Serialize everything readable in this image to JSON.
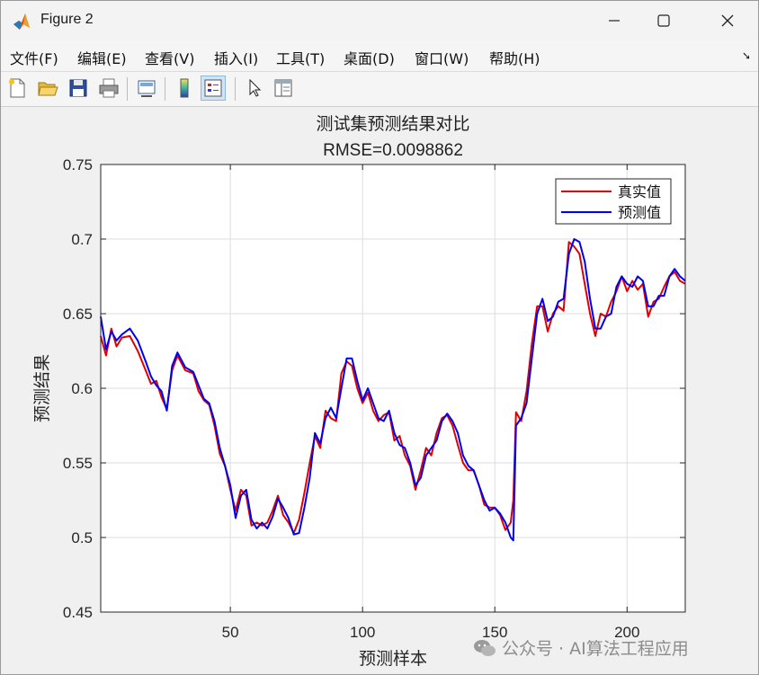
{
  "window": {
    "title": "Figure 2"
  },
  "menu": [
    "文件(F)",
    "编辑(E)",
    "查看(V)",
    "插入(I)",
    "工具(T)",
    "桌面(D)",
    "窗口(W)",
    "帮助(H)"
  ],
  "toolbar_icons": [
    "new-figure-icon",
    "open-file-icon",
    "save-icon",
    "print-icon",
    "link-plot-icon",
    "colorbar-icon",
    "legend-icon",
    "pointer-icon",
    "property-inspector-icon"
  ],
  "watermark": "公众号 · AI算法工程应用",
  "colors": {
    "true_line": "#e00000",
    "pred_line": "#0000f0"
  },
  "chart_data": {
    "type": "line",
    "title": "测试集预测结果对比",
    "subtitle": "RMSE=0.0098862",
    "xlabel": "预测样本",
    "ylabel": "预测结果",
    "xlim": [
      1,
      222
    ],
    "ylim": [
      0.45,
      0.75
    ],
    "xticks": [
      50,
      100,
      150,
      200
    ],
    "yticks": [
      0.45,
      0.5,
      0.55,
      0.6,
      0.65,
      0.7,
      0.75
    ],
    "xtick_labels": [
      "50",
      "100",
      "150",
      "200"
    ],
    "ytick_labels": [
      "0.45",
      "0.5",
      "0.55",
      "0.6",
      "0.65",
      "0.7",
      "0.75"
    ],
    "grid": true,
    "legend_position": "top-right",
    "series": [
      {
        "name": "真实值",
        "color": "#e00000",
        "x": [
          1,
          3,
          5,
          7,
          9,
          12,
          15,
          18,
          20,
          22,
          24,
          26,
          28,
          30,
          33,
          36,
          38,
          40,
          42,
          44,
          46,
          48,
          50,
          52,
          54,
          56,
          58,
          60,
          62,
          64,
          66,
          68,
          70,
          72,
          74,
          76,
          78,
          80,
          82,
          84,
          86,
          88,
          90,
          92,
          94,
          96,
          98,
          100,
          102,
          104,
          106,
          108,
          110,
          112,
          114,
          116,
          118,
          120,
          122,
          124,
          126,
          128,
          130,
          132,
          134,
          136,
          138,
          140,
          142,
          144,
          146,
          148,
          150,
          152,
          154,
          156,
          157,
          158,
          160,
          162,
          164,
          166,
          168,
          170,
          172,
          174,
          176,
          178,
          180,
          182,
          184,
          186,
          188,
          190,
          192,
          194,
          196,
          198,
          200,
          202,
          204,
          206,
          208,
          210,
          212,
          214,
          216,
          218,
          220,
          222
        ],
        "y": [
          0.635,
          0.622,
          0.64,
          0.628,
          0.634,
          0.635,
          0.625,
          0.612,
          0.603,
          0.605,
          0.594,
          0.586,
          0.612,
          0.622,
          0.612,
          0.61,
          0.598,
          0.592,
          0.589,
          0.575,
          0.556,
          0.548,
          0.532,
          0.518,
          0.532,
          0.528,
          0.508,
          0.51,
          0.508,
          0.51,
          0.518,
          0.528,
          0.515,
          0.51,
          0.503,
          0.512,
          0.53,
          0.55,
          0.568,
          0.56,
          0.585,
          0.58,
          0.578,
          0.61,
          0.618,
          0.615,
          0.6,
          0.59,
          0.597,
          0.585,
          0.578,
          0.582,
          0.584,
          0.565,
          0.568,
          0.555,
          0.548,
          0.532,
          0.545,
          0.56,
          0.555,
          0.57,
          0.58,
          0.582,
          0.575,
          0.562,
          0.55,
          0.545,
          0.545,
          0.535,
          0.522,
          0.52,
          0.52,
          0.515,
          0.505,
          0.51,
          0.525,
          0.584,
          0.578,
          0.598,
          0.63,
          0.655,
          0.655,
          0.638,
          0.65,
          0.655,
          0.652,
          0.698,
          0.695,
          0.69,
          0.67,
          0.65,
          0.635,
          0.65,
          0.648,
          0.658,
          0.665,
          0.675,
          0.665,
          0.672,
          0.666,
          0.67,
          0.648,
          0.658,
          0.66,
          0.668,
          0.675,
          0.678,
          0.672,
          0.67
        ]
      },
      {
        "name": "预测值",
        "color": "#0000f0",
        "x": [
          1,
          3,
          5,
          7,
          9,
          12,
          15,
          18,
          20,
          22,
          24,
          26,
          28,
          30,
          33,
          36,
          38,
          40,
          42,
          44,
          46,
          48,
          50,
          52,
          54,
          56,
          58,
          60,
          62,
          64,
          66,
          68,
          70,
          72,
          74,
          76,
          78,
          80,
          82,
          84,
          86,
          88,
          90,
          92,
          94,
          96,
          98,
          100,
          102,
          104,
          106,
          108,
          110,
          112,
          114,
          116,
          118,
          120,
          122,
          124,
          126,
          128,
          130,
          132,
          134,
          136,
          138,
          140,
          142,
          144,
          146,
          148,
          150,
          152,
          154,
          156,
          157,
          158,
          160,
          162,
          164,
          166,
          168,
          170,
          172,
          174,
          176,
          178,
          180,
          182,
          184,
          186,
          188,
          190,
          192,
          194,
          196,
          198,
          200,
          202,
          204,
          206,
          208,
          210,
          212,
          214,
          216,
          218,
          220,
          222
        ],
        "y": [
          0.648,
          0.626,
          0.638,
          0.632,
          0.636,
          0.64,
          0.632,
          0.618,
          0.608,
          0.602,
          0.598,
          0.585,
          0.615,
          0.624,
          0.614,
          0.611,
          0.602,
          0.593,
          0.59,
          0.578,
          0.56,
          0.548,
          0.535,
          0.513,
          0.528,
          0.532,
          0.512,
          0.506,
          0.51,
          0.506,
          0.514,
          0.526,
          0.52,
          0.513,
          0.502,
          0.503,
          0.52,
          0.54,
          0.57,
          0.563,
          0.58,
          0.587,
          0.58,
          0.6,
          0.62,
          0.62,
          0.605,
          0.592,
          0.6,
          0.59,
          0.58,
          0.578,
          0.585,
          0.57,
          0.562,
          0.56,
          0.55,
          0.535,
          0.54,
          0.555,
          0.56,
          0.565,
          0.578,
          0.583,
          0.578,
          0.57,
          0.555,
          0.548,
          0.545,
          0.535,
          0.525,
          0.518,
          0.52,
          0.516,
          0.51,
          0.5,
          0.498,
          0.575,
          0.58,
          0.59,
          0.62,
          0.65,
          0.66,
          0.645,
          0.648,
          0.658,
          0.66,
          0.69,
          0.7,
          0.698,
          0.685,
          0.66,
          0.64,
          0.64,
          0.648,
          0.65,
          0.668,
          0.675,
          0.67,
          0.668,
          0.675,
          0.672,
          0.655,
          0.655,
          0.662,
          0.662,
          0.675,
          0.68,
          0.675,
          0.672
        ]
      }
    ]
  }
}
